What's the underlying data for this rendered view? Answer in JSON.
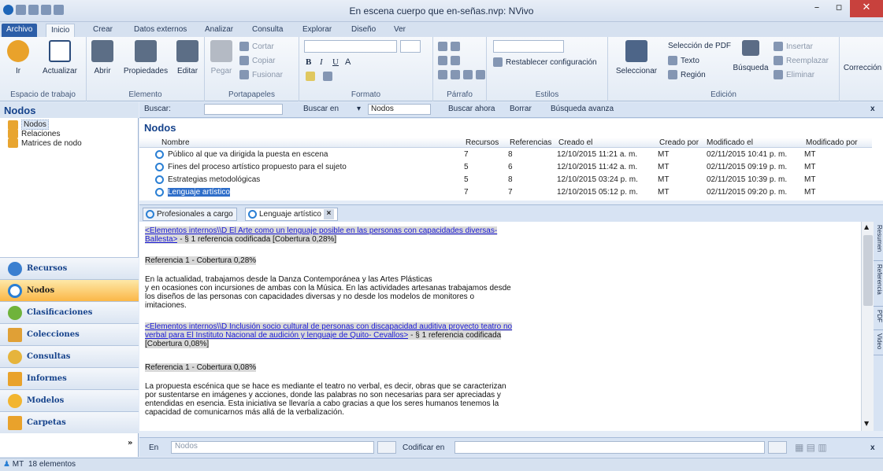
{
  "window": {
    "title": "En escena cuerpo que en-señas.nvp: NVivo",
    "controls": [
      "–",
      "▫",
      "✕"
    ]
  },
  "ribbon_tabs": [
    "Archivo",
    "Inicio",
    "Crear",
    "Datos externos",
    "Analizar",
    "Consulta",
    "Explorar",
    "Diseño",
    "Ver"
  ],
  "ribbon": {
    "workspace": {
      "go": "Ir",
      "refresh": "Actualizar",
      "label": "Espacio de trabajo"
    },
    "item": {
      "open": "Abrir",
      "properties": "Propiedades",
      "edit": "Editar",
      "label": "Elemento"
    },
    "clipboard": {
      "paste": "Pegar",
      "cut": "Cortar",
      "copy": "Copiar",
      "merge": "Fusionar",
      "label": "Portapapeles"
    },
    "format": {
      "label": "Formato"
    },
    "paragraph": {
      "label": "Párrafo"
    },
    "styles": {
      "reset": "Restablecer configuración",
      "label": "Estilos"
    },
    "editing": {
      "select": "Seleccionar",
      "pdf_selection": "Selección de PDF",
      "text": "Texto",
      "region": "Región",
      "search": "Búsqueda",
      "insert": "Insertar",
      "replace": "Reemplazar",
      "delete": "Eliminar",
      "label": "Edición"
    },
    "proofing": {
      "label": "Corrección"
    }
  },
  "nav": {
    "title": "Nodos",
    "tree": [
      "Nodos",
      "Relaciones",
      "Matrices de nodo"
    ],
    "sections": [
      "Recursos",
      "Nodos",
      "Clasificaciones",
      "Colecciones",
      "Consultas",
      "Informes",
      "Modelos",
      "Carpetas"
    ]
  },
  "findbar": {
    "search_label": "Buscar:",
    "search_in": "Buscar en",
    "scope": "Nodos",
    "find_now": "Buscar ahora",
    "clear": "Borrar",
    "advanced": "Búsqueda avanza",
    "close": "x"
  },
  "list": {
    "title": "Nodos",
    "columns": [
      "Nombre",
      "Recursos",
      "Referencias",
      "Creado el",
      "Creado por",
      "Modificado el",
      "Modificado por"
    ],
    "rows": [
      {
        "name": "Público al que va dirigida la puesta en escena",
        "sources": "7",
        "refs": "8",
        "created": "12/10/2015 11:21 a. m.",
        "by": "MT",
        "modified": "02/11/2015 10:41 p. m.",
        "modby": "MT"
      },
      {
        "name": "Fines del proceso artístico propuesto para el sujeto",
        "sources": "5",
        "refs": "6",
        "created": "12/10/2015 11:42 a. m.",
        "by": "MT",
        "modified": "02/11/2015 09:19 p. m.",
        "modby": "MT"
      },
      {
        "name": "Estrategias metodológicas",
        "sources": "5",
        "refs": "8",
        "created": "12/10/2015 03:24 p. m.",
        "by": "MT",
        "modified": "02/11/2015 10:39 p. m.",
        "modby": "MT"
      },
      {
        "name": "Lenguaje artístico",
        "sources": "7",
        "refs": "7",
        "created": "12/10/2015 05:12 p. m.",
        "by": "MT",
        "modified": "02/11/2015 09:20 p. m.",
        "modby": "MT"
      }
    ]
  },
  "detail_tabs": [
    "Profesionales  a cargo",
    "Lenguaje artístico"
  ],
  "detail": {
    "link1_a": "<Elementos internos\\\\D El Arte como un lenguaje posible en las personas con capacidades diversas-",
    "link1_b": "Ballesta>",
    "link1_tail": " - § 1 referencia codificada  [Cobertura 0,28%]",
    "ref1": "Referencia 1 - Cobertura 0,28%",
    "para1": [
      "En la actualidad, trabajamos desde la Danza Contemporánea y las Artes Plásticas",
      "y en ocasiones con incursiones de ambas con la Música. En las actividades artesanas trabajamos desde",
      "los diseños de las personas con capacidades diversas y no desde los modelos de monitores o",
      "imitaciones."
    ],
    "link2_a": "<Elementos internos\\\\D Inclusión socio cultural de personas con discapacidad auditiva proyecto teatro no",
    "link2_b": "verbal para El Instituto Nacional de audición y lenguaje de Quito- Cevallos>",
    "link2_tail": " - § 1 referencia codificada ",
    "link2_c": "[Cobertura 0,08%]",
    "ref2": "Referencia 1 - Cobertura 0,08%",
    "para2": [
      "La propuesta escénica que se hace es mediante el teatro no verbal, es decir, obras que se caracterizan",
      "por sustentarse en imágenes y acciones, donde las palabras no son necesarias para ser apreciadas y",
      "entendidas en esencia. Esta iniciativa se llevaría a cabo gracias a que los seres humanos tenemos la",
      "capacidad de comunicarnos más allá de la verbalización."
    ]
  },
  "side_tabs": [
    "Resumen",
    "Referencia",
    "PDF",
    "Video"
  ],
  "codebar": {
    "in": "En",
    "in_value": "Nodos",
    "code_in": "Codificar en",
    "close": "x"
  },
  "status": {
    "user": "MT",
    "count": "18 elementos"
  },
  "colors": {
    "accent": "#15428b",
    "selection": "#2f6ec9",
    "active_section": "#fbb747",
    "link": "#1a1ad6"
  }
}
